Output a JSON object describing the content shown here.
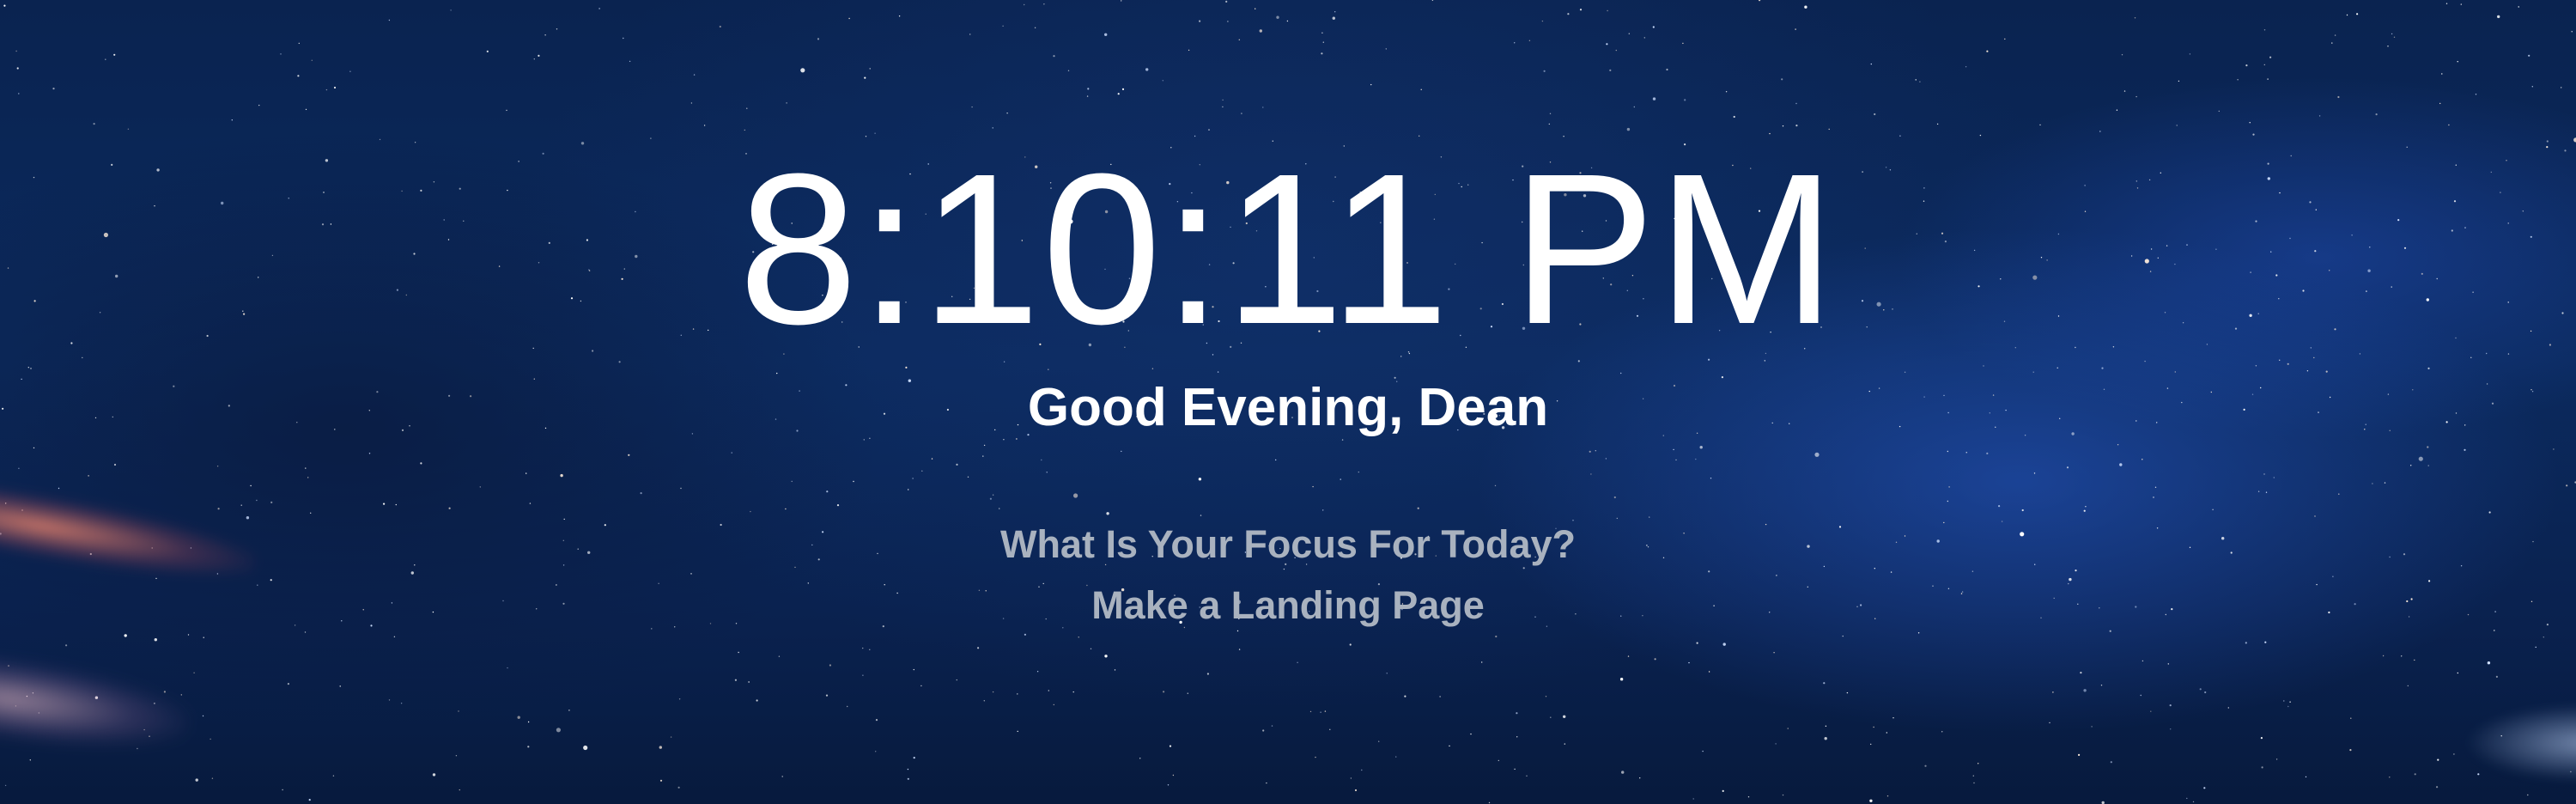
{
  "clock": {
    "time": "8:10:11 PM"
  },
  "greeting": {
    "text": "Good Evening, Dean"
  },
  "focus": {
    "question": "What Is Your Focus For Today?",
    "answer": "Make a Landing Page"
  },
  "background": {
    "scene": "starry-night-sky",
    "base_color": "#0a2350",
    "accent_color": "#2a5ac8"
  }
}
